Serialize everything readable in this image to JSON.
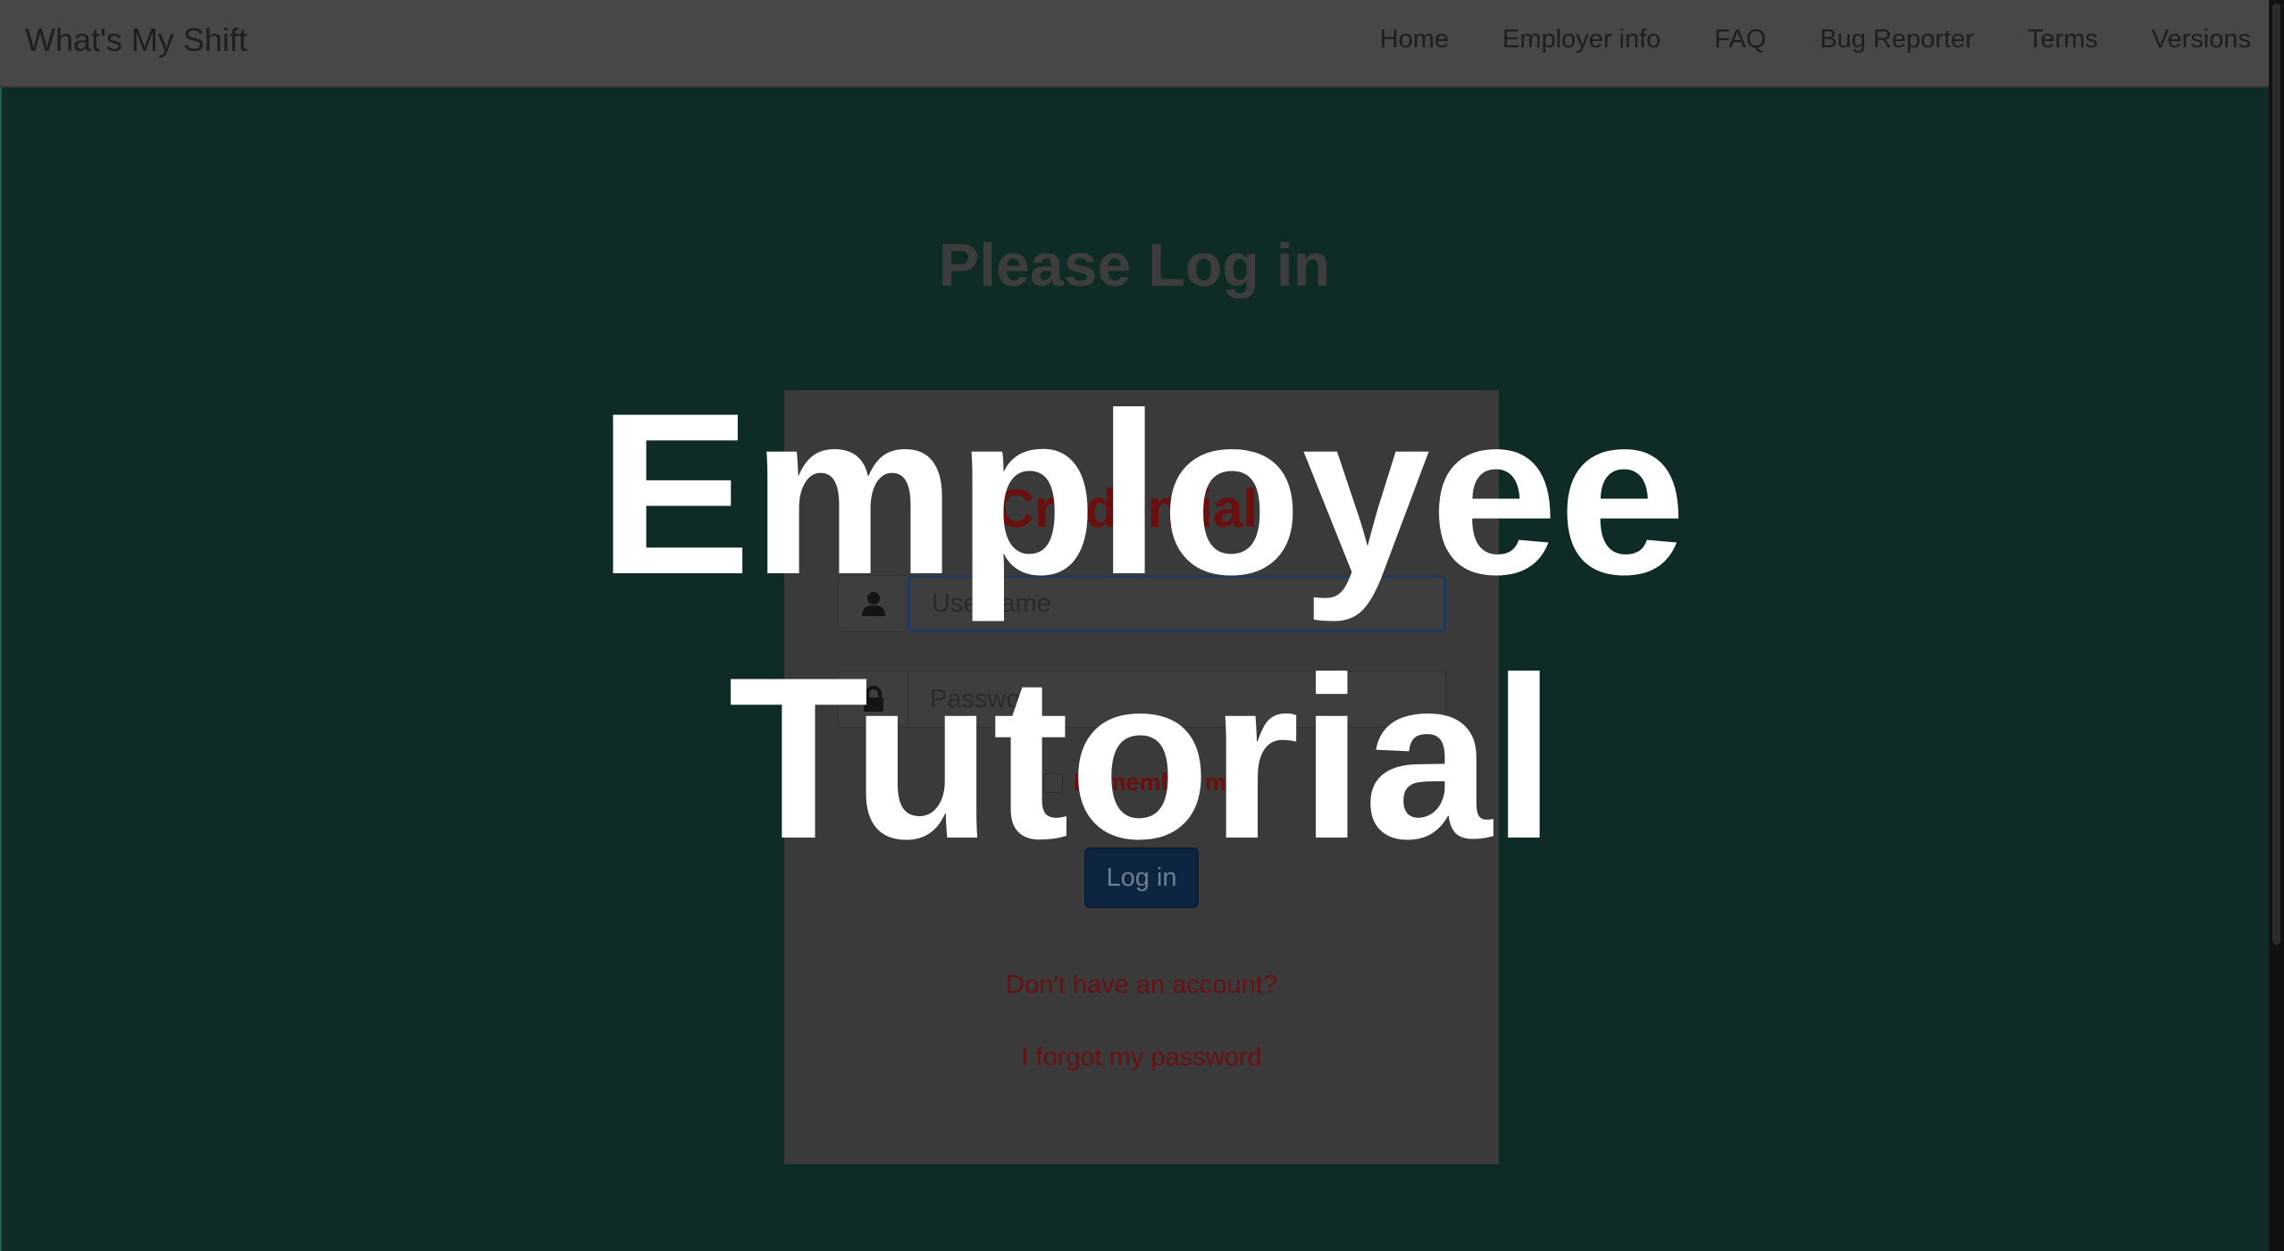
{
  "navbar": {
    "brand": "What's My Shift",
    "links": [
      "Home",
      "Employer info",
      "FAQ",
      "Bug Reporter",
      "Terms",
      "Versions"
    ]
  },
  "main": {
    "title": "Please Log in"
  },
  "login_panel": {
    "title": "Credentials",
    "username_placeholder": "Username",
    "password_placeholder": "Password",
    "remember_label": "Remember me",
    "login_button": "Log in",
    "signup_link": "Don't have an account?",
    "forgot_link": "I forgot my password"
  },
  "overlay": {
    "line1": "Employee",
    "line2": "Tutorial"
  },
  "icons": {
    "username": "user-icon",
    "password": "lock-icon"
  },
  "colors": {
    "background": "#0e2b27",
    "navbar": "#474747",
    "panel": "#3a3a3b",
    "accent_red": "#6a0e0e",
    "button": "#0d2540",
    "overlay_text": "#ffffff"
  }
}
